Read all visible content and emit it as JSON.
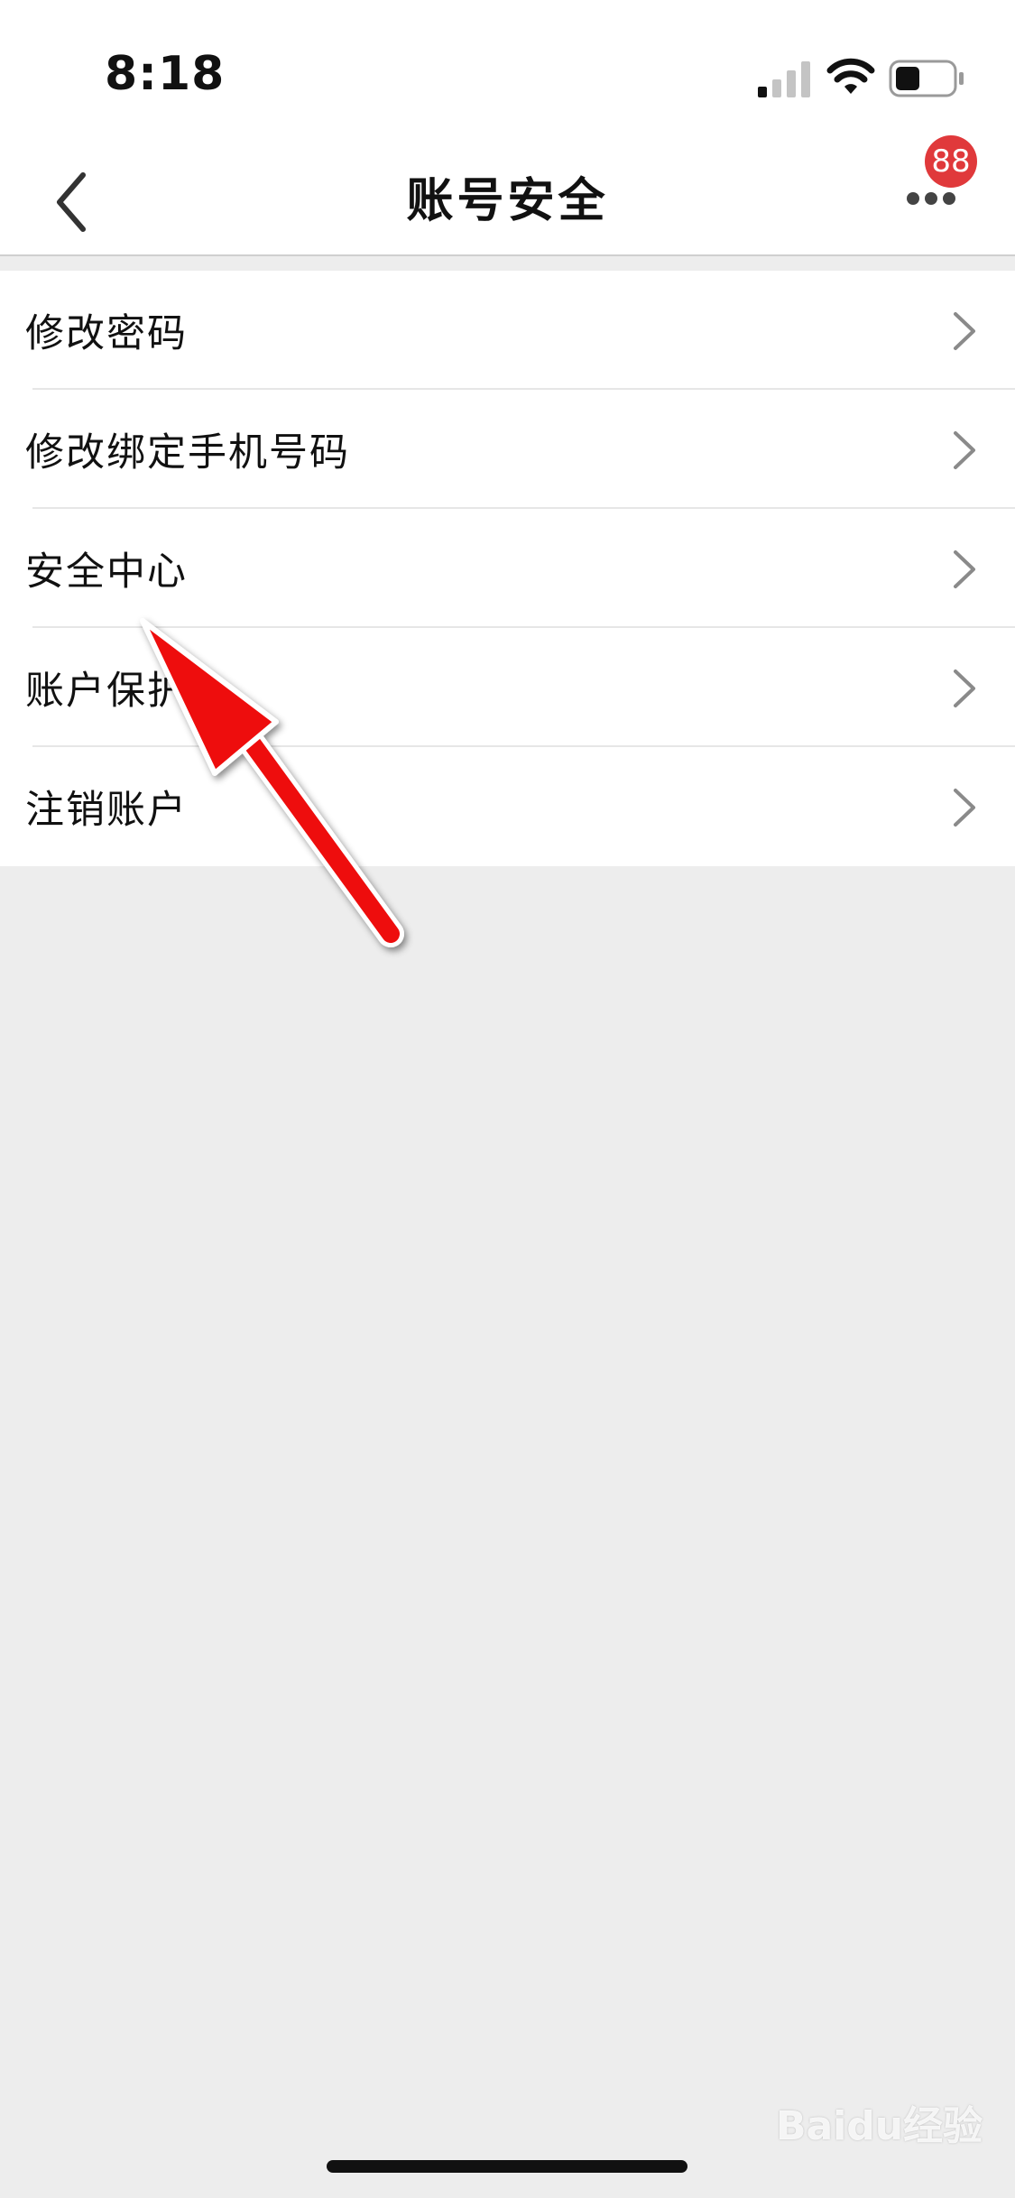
{
  "status_bar": {
    "time": "8:18",
    "icons": [
      "signal-icon",
      "wifi-icon",
      "battery-icon"
    ]
  },
  "nav": {
    "title": "账号安全",
    "back_icon": "chevron-left-icon",
    "more_icon": "more-dots-icon",
    "badge_count": "88"
  },
  "settings": {
    "items": [
      {
        "label": "修改密码"
      },
      {
        "label": "修改绑定手机号码"
      },
      {
        "label": "安全中心"
      },
      {
        "label": "账户保护"
      },
      {
        "label": "注销账户"
      }
    ]
  },
  "watermark": "Baidu经验",
  "colors": {
    "badge": "#e0393b",
    "arrow": "#ee0a0a",
    "background": "#ededed"
  }
}
